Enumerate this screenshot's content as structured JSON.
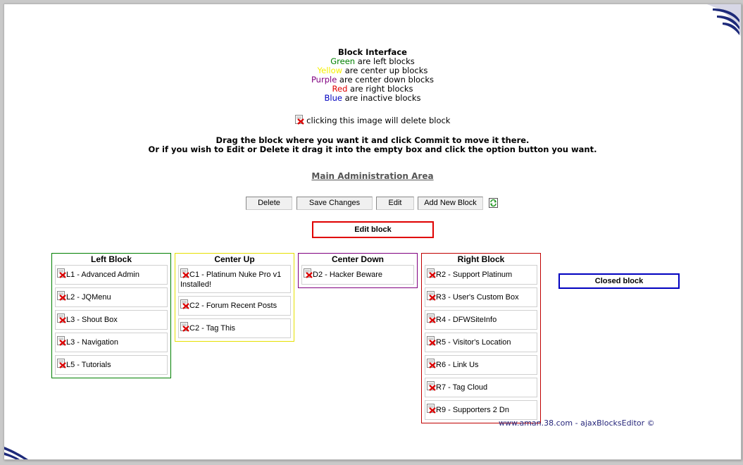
{
  "legend": {
    "title": "Block Interface",
    "lines": [
      {
        "color_word": "Green",
        "color": "#008000",
        "rest": " are left blocks"
      },
      {
        "color_word": "Yellow",
        "color": "#f5f000",
        "rest": " are center up blocks"
      },
      {
        "color_word": "Purple",
        "color": "#800080",
        "rest": " are center down blocks"
      },
      {
        "color_word": "Red",
        "color": "#e00000",
        "rest": " are right blocks"
      },
      {
        "color_word": "Blue",
        "color": "#0000c0",
        "rest": " are inactive blocks"
      }
    ],
    "delete_hint": " clicking this image will delete block"
  },
  "instructions": {
    "line1": "Drag the block where you want it and click Commit to move it there.",
    "line2": "Or if you wish to Edit or Delete it drag it into the empty box and click the option button you want."
  },
  "main_link": "Main Administration Area",
  "buttons": {
    "delete": "Delete",
    "save": "Save Changes",
    "edit": "Edit",
    "add": "Add New Block"
  },
  "edit_block": {
    "label": "Edit block",
    "color": "#e00000"
  },
  "zones": {
    "left": {
      "title": "Left Block",
      "color": "#008000",
      "blocks": [
        "L1 - Advanced Admin",
        "L2 - JQMenu",
        "L3 - Shout Box",
        "L3 - Navigation",
        "L5 - Tutorials"
      ]
    },
    "center_up": {
      "title": "Center Up",
      "color": "#e6e000",
      "blocks": [
        "C1 - Platinum Nuke Pro v1 Installed!",
        "C2 - Forum Recent Posts",
        "C2 - Tag This"
      ]
    },
    "center_down": {
      "title": "Center Down",
      "color": "#800080",
      "blocks": [
        "D2 - Hacker Beware"
      ]
    },
    "right": {
      "title": "Right Block",
      "color": "#c00000",
      "blocks": [
        "R2 - Support Platinum",
        "R3 - User's Custom Box",
        "R4 - DFWSiteInfo",
        "R5 - Visitor's Location",
        "R6 - Link Us",
        "R7 - Tag Cloud",
        "R9 - Supporters 2 Dn"
      ]
    }
  },
  "closed_block": {
    "label": "Closed block",
    "color": "#0000c0"
  },
  "footer": "www.aman.38.com - ajaxBlocksEditor ©"
}
